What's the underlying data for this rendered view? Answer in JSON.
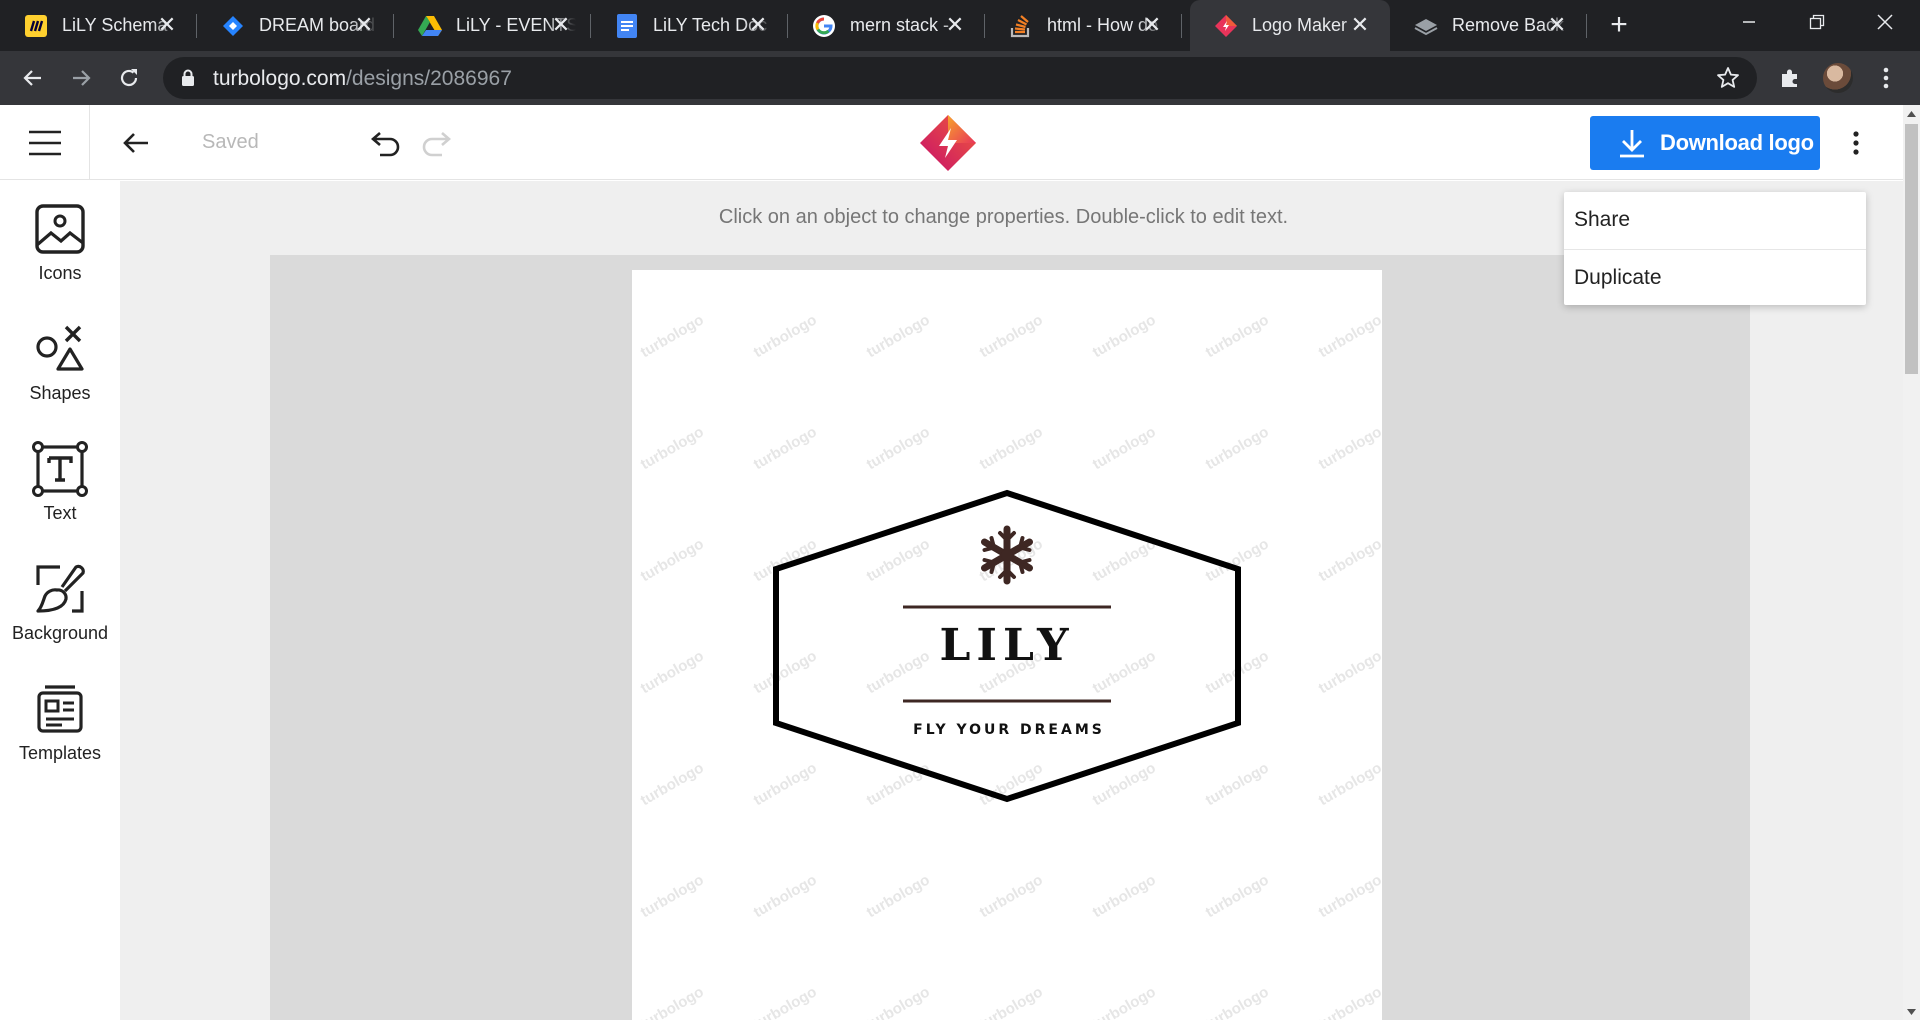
{
  "browser": {
    "tabs": [
      {
        "title": "LiLY Schema",
        "icon": "miro-icon",
        "color": "#ffd02f"
      },
      {
        "title": "DREAM board",
        "icon": "jira-icon",
        "color": "#2684ff"
      },
      {
        "title": "LiLY - EVENTS",
        "icon": "drive-icon",
        "color": "#34a853"
      },
      {
        "title": "LiLY Tech Doc",
        "icon": "docs-icon",
        "color": "#4285f4"
      },
      {
        "title": "mern stack -",
        "icon": "google-icon",
        "color": "#ea4335"
      },
      {
        "title": "html - How do",
        "icon": "stackoverflow-icon",
        "color": "#f48024"
      },
      {
        "title": "Logo Maker",
        "icon": "turbologo-icon",
        "color": "#e8345a",
        "active": true
      },
      {
        "title": "Remove Back",
        "icon": "layers-icon",
        "color": "#9aa0a6"
      }
    ],
    "url_host": "turbologo.com",
    "url_path": "/designs/2086967"
  },
  "header": {
    "saved_label": "Saved",
    "download_label": "Download logo",
    "accent_color": "#1a7cf0"
  },
  "sidebar": {
    "items": [
      {
        "label": "Icons",
        "icon": "image-icon"
      },
      {
        "label": "Shapes",
        "icon": "shapes-icon"
      },
      {
        "label": "Text",
        "icon": "text-icon"
      },
      {
        "label": "Background",
        "icon": "brush-icon"
      },
      {
        "label": "Templates",
        "icon": "templates-icon"
      }
    ]
  },
  "workspace": {
    "hint": "Click on an object to change properties. Double-click to edit text.",
    "watermark_text": "turbologo"
  },
  "logo": {
    "name": "LILY",
    "tagline": "FLY YOUR DREAMS",
    "icon": "snowflake-icon"
  },
  "menu": {
    "items": [
      "Share",
      "Duplicate"
    ]
  }
}
